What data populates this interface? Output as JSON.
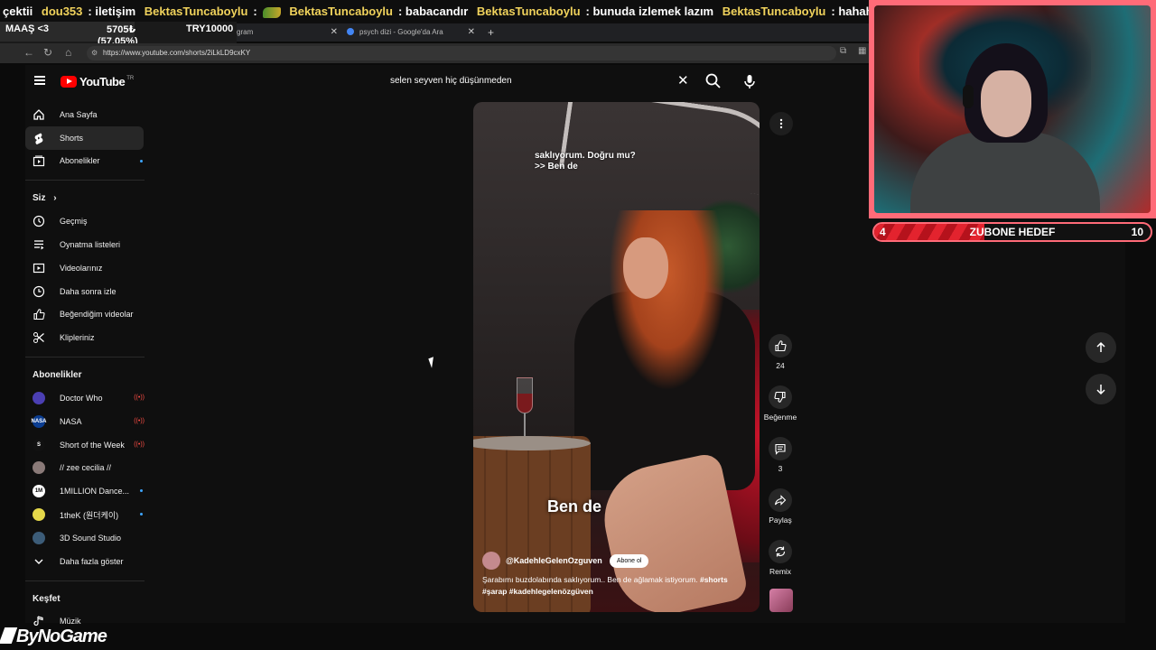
{
  "ticker": {
    "items": [
      {
        "user": "",
        "msg": "çektii"
      },
      {
        "user": "dou353",
        "msg": ": iletişim"
      },
      {
        "user": "BektasTuncaboylu",
        "msg": ":"
      },
      {
        "user": "BektasTuncaboylu",
        "msg": ": babacandır"
      },
      {
        "user": "BektasTuncaboylu",
        "msg": ": bunuda izlemek lazım"
      },
      {
        "user": "BektasTuncaboylu",
        "msg": ": hahahahahah"
      }
    ]
  },
  "salary_widget": {
    "label": "MAAŞ <3",
    "current": "5705₺",
    "target": "TRY10000",
    "percent_text": "(57.05%)",
    "progress": 0.5705
  },
  "browser": {
    "tabs": [
      {
        "label": "gram"
      },
      {
        "label": "psych dizi - Google'da Ara"
      }
    ],
    "new_tab": "+",
    "url": "https://www.youtube.com/shorts/2iLkLD9cxKY"
  },
  "youtube": {
    "logo_text": "YouTube",
    "logo_suffix": "TR",
    "search_query": "selen seyven hiç düşünmeden",
    "nav_main": [
      {
        "label": "Ana Sayfa",
        "icon": "home-icon",
        "active": false
      },
      {
        "label": "Shorts",
        "icon": "shorts-icon",
        "active": true
      },
      {
        "label": "Abonelikler",
        "icon": "subscriptions-icon",
        "active": false
      }
    ],
    "you_title": "Siz",
    "nav_you": [
      {
        "label": "Geçmiş",
        "icon": "history-icon"
      },
      {
        "label": "Oynatma listeleri",
        "icon": "playlists-icon"
      },
      {
        "label": "Videolarınız",
        "icon": "your-videos-icon"
      },
      {
        "label": "Daha sonra izle",
        "icon": "watch-later-icon"
      },
      {
        "label": "Beğendiğim videolar",
        "icon": "liked-videos-icon"
      },
      {
        "label": "Klipleriniz",
        "icon": "clips-icon"
      }
    ],
    "subs_title": "Abonelikler",
    "subscriptions": [
      {
        "label": "Doctor Who",
        "badge": "live",
        "color": "#4b3fb3",
        "initials": ""
      },
      {
        "label": "NASA",
        "badge": "live",
        "color": "#0b3d91",
        "initials": "NASA"
      },
      {
        "label": "Short of the Week",
        "badge": "live",
        "color": "#111111",
        "initials": "S"
      },
      {
        "label": "// zee cecilia //",
        "badge": "",
        "color": "#8a7a78",
        "initials": ""
      },
      {
        "label": "1MILLION Dance...",
        "badge": "dot",
        "color": "#ffffff",
        "initials": "1M"
      },
      {
        "label": "1theK (원더케이)",
        "badge": "dot",
        "color": "#e5d84a",
        "initials": ""
      },
      {
        "label": "3D Sound Studio",
        "badge": "",
        "color": "#3c5c78",
        "initials": ""
      }
    ],
    "show_more": "Daha fazla göster",
    "explore_title": "Keşfet",
    "explore": [
      {
        "label": "Müzik",
        "icon": "music-icon"
      }
    ]
  },
  "short": {
    "caption_top_lines": [
      "saklıyorum. Doğru mu?",
      ">> Ben de"
    ],
    "caption_big": "Ben  de",
    "channel": "@KadehleGelenOzguven",
    "subscribe_label": "Abone ol",
    "description": "Şarabımı buzdolabında saklıyorum.. Ben de ağlamak istiyorum.",
    "hashtags": [
      "#shorts",
      "#şarap",
      "#kadehlegelenözgüven"
    ],
    "likes": "24",
    "dislike_label": "Beğenme",
    "comments": "3",
    "share_label": "Paylaş",
    "remix_label": "Remix"
  },
  "goal_widget": {
    "current": "4",
    "label": "ZUBONE HEDEF",
    "target": "10",
    "progress": 0.4
  },
  "brand": {
    "text": "ByNoGame"
  }
}
